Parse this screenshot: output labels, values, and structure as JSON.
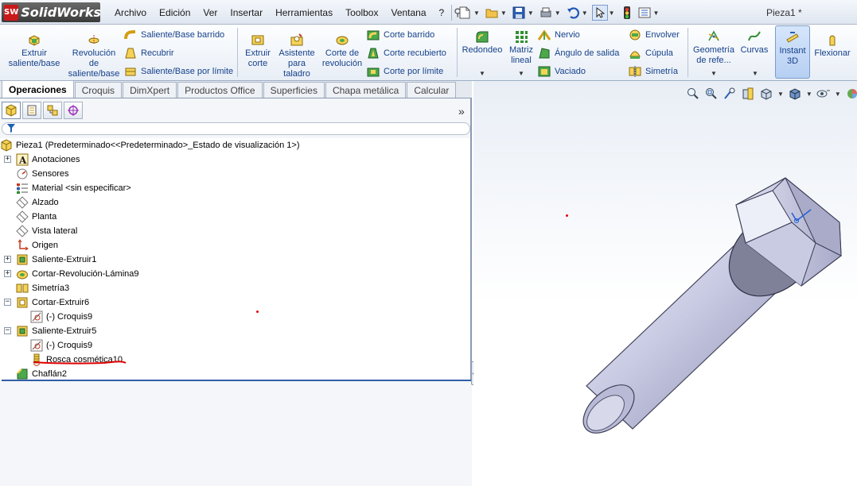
{
  "app": {
    "brand_badge": "SW",
    "brand_name": "SolidWorks",
    "document_title": "Pieza1 *"
  },
  "menu": [
    "Archivo",
    "Edición",
    "Ver",
    "Insertar",
    "Herramientas",
    "Toolbox",
    "Ventana",
    "?"
  ],
  "quick_access": [
    "new-document-icon",
    "open-icon",
    "save-icon",
    "print-icon",
    "undo-icon",
    "select-icon",
    "rebuild-icon",
    "options-icon"
  ],
  "ribbon": {
    "extrude_boss": "Extruir saliente/base",
    "revolve_boss": "Revolución de saliente/base",
    "swept_boss": "Saliente/Base barrido",
    "recubrir": "Recubrir",
    "boundary_boss": "Saliente/Base por límite",
    "extrude_cut": "Extruir corte",
    "hole_wizard": "Asistente para taladro",
    "revolve_cut": "Corte de revolución",
    "swept_cut": "Corte barrido",
    "loft_cut": "Corte recubierto",
    "boundary_cut": "Corte por límite",
    "fillet": "Redondeo",
    "linear_pattern": "Matriz lineal",
    "rib": "Nervio",
    "draft": "Ángulo de salida",
    "shell": "Vaciado",
    "wrap": "Envolver",
    "dome": "Cúpula",
    "mirror": "Simetría",
    "ref_geometry": "Geometría de refe...",
    "curves": "Curvas",
    "instant3d": "Instant 3D",
    "flex": "Flexionar"
  },
  "tabs": [
    "Operaciones",
    "Croquis",
    "DimXpert",
    "Productos Office",
    "Superficies",
    "Chapa metálica",
    "Calcular"
  ],
  "active_tab": "Operaciones",
  "feature_manager": {
    "panel_tabs": [
      "feature-tree-icon",
      "property-manager-icon",
      "configuration-manager-icon",
      "dimxpert-manager-icon"
    ],
    "expand_glyph": "»",
    "tree": [
      {
        "label": "Pieza1  (Predeterminado<<Predeterminado>_Estado de visualización 1>)",
        "icon": "part-icon"
      },
      {
        "label": "Anotaciones",
        "icon": "annotations-icon",
        "toggle": "+"
      },
      {
        "label": "Sensores",
        "icon": "sensors-icon"
      },
      {
        "label": "Material <sin especificar>",
        "icon": "material-icon"
      },
      {
        "label": "Alzado",
        "icon": "plane-icon"
      },
      {
        "label": "Planta",
        "icon": "plane-icon"
      },
      {
        "label": "Vista lateral",
        "icon": "plane-icon"
      },
      {
        "label": "Origen",
        "icon": "origin-icon"
      },
      {
        "label": "Saliente-Extruir1",
        "icon": "extrude-boss-icon",
        "toggle": "+"
      },
      {
        "label": "Cortar-Revolución-Lámina9",
        "icon": "revolve-cut-icon",
        "toggle": "+"
      },
      {
        "label": "Simetría3",
        "icon": "mirror-icon"
      },
      {
        "label": "Cortar-Extruir6",
        "icon": "extrude-cut-icon",
        "toggle": "−"
      },
      {
        "label": "(-) Croquis9",
        "icon": "sketch-icon"
      },
      {
        "label": "Saliente-Extruir5",
        "icon": "extrude-boss-icon",
        "toggle": "−"
      },
      {
        "label": "(-) Croquis9",
        "icon": "sketch-icon"
      },
      {
        "label": "Rosca cosmética10",
        "icon": "cosmetic-thread-icon"
      },
      {
        "label": "Chaflán2",
        "icon": "chamfer-icon"
      }
    ]
  },
  "heads_up_toolbar": [
    "zoom-to-fit-icon",
    "zoom-area-icon",
    "previous-view-icon",
    "section-view-icon",
    "view-orientation-icon",
    "display-style-icon",
    "hide-show-icon",
    "appearance-icon"
  ],
  "colors": {
    "ribbon_text": "#15408a",
    "annotation_red": "#e00000",
    "rollback_bar": "#315ea7",
    "bolt_body": "#c5c7e0"
  }
}
